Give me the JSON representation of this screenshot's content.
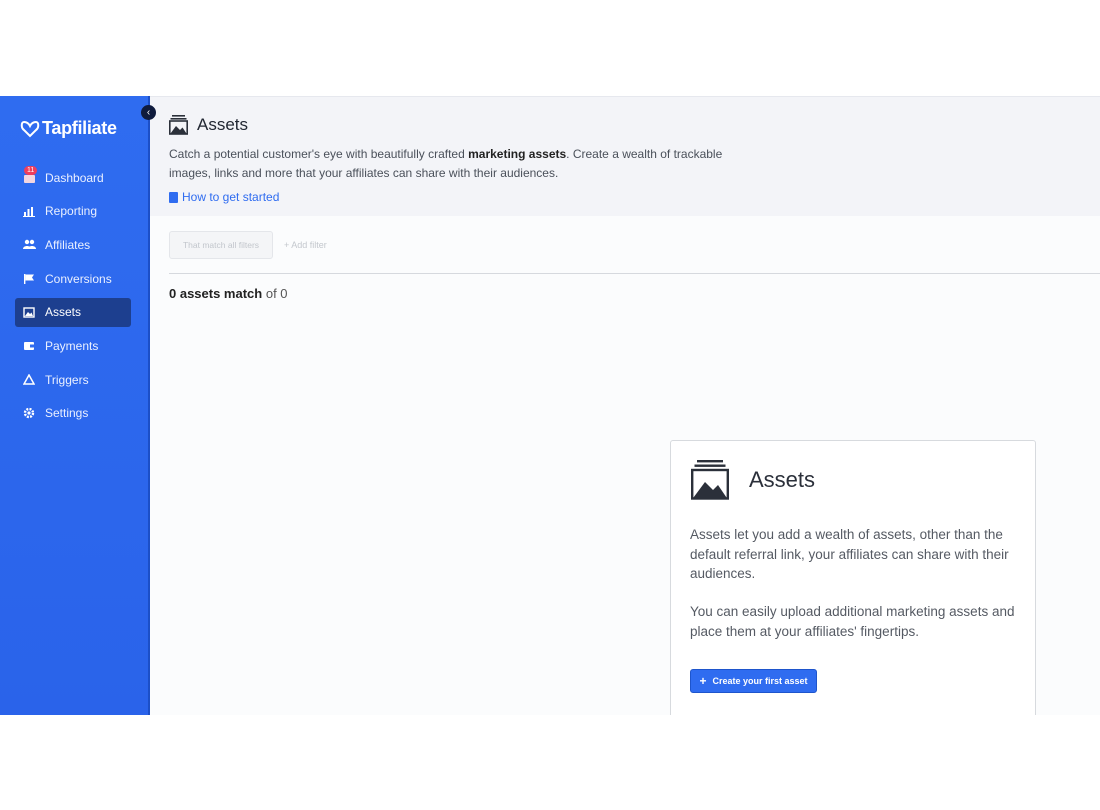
{
  "app": {
    "brand": "Tapfiliate",
    "accent": "#2f6cf0"
  },
  "sidebar": {
    "items": [
      {
        "label": "Dashboard",
        "icon": "dashboard-icon",
        "badge": "11"
      },
      {
        "label": "Reporting",
        "icon": "bar-chart-icon"
      },
      {
        "label": "Affiliates",
        "icon": "users-icon"
      },
      {
        "label": "Conversions",
        "icon": "flag-icon"
      },
      {
        "label": "Assets",
        "icon": "image-icon",
        "active": true
      },
      {
        "label": "Payments",
        "icon": "wallet-icon"
      },
      {
        "label": "Triggers",
        "icon": "triangle-icon"
      },
      {
        "label": "Settings",
        "icon": "gear-icon"
      }
    ]
  },
  "header": {
    "title": "Assets",
    "desc_pre": "Catch a potential customer's eye with beautifully crafted ",
    "desc_bold": "marketing assets",
    "desc_post": ". Create a wealth of trackable images, links and more that your affiliates can share with their audiences.",
    "link": "How to get started"
  },
  "filters": {
    "match_all": "That match all filters",
    "add_filter": "Add filter"
  },
  "results": {
    "count_bold": "0 assets match",
    "count_rest": " of 0"
  },
  "card": {
    "title": "Assets",
    "p1": "Assets let you add a wealth of assets, other than the default referral link, your affiliates can share with their audiences.",
    "p2": "You can easily upload additional marketing assets and place them at your affiliates' fingertips.",
    "button": "Create your first asset"
  }
}
